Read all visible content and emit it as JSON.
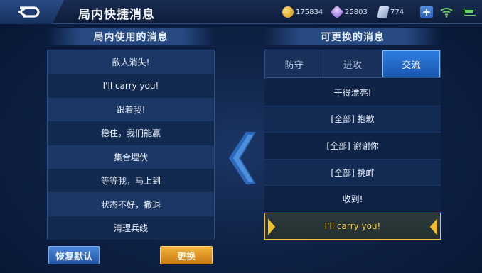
{
  "header": {
    "title": "局内快捷消息",
    "currencies": [
      {
        "icon": "gold-coin-icon",
        "value": "175834"
      },
      {
        "icon": "diamond-icon",
        "value": "25803"
      },
      {
        "icon": "voucher-icon",
        "value": "774"
      }
    ]
  },
  "left_panel": {
    "title": "局内使用的消息",
    "items": [
      "敌人消失!",
      "I'll carry you!",
      "跟着我!",
      "稳住，我们能赢",
      "集合埋伏",
      "等等我，马上到",
      "状态不好，撤退",
      "清理兵线"
    ]
  },
  "right_panel": {
    "title": "可更换的消息",
    "tabs": [
      "防守",
      "进攻",
      "交流"
    ],
    "active_tab": "交流",
    "items": [
      "干得漂亮!",
      "[全部] 抱歉",
      "[全部] 谢谢你",
      "[全部] 挑衅",
      "收到!",
      "I'll carry you!"
    ],
    "selected_item": "I'll carry you!"
  },
  "buttons": {
    "reset": "恢复默认",
    "replace": "更换"
  },
  "colors": {
    "accent_blue": "#2f7ee0",
    "selected_gold": "#f0c030",
    "replace_orange": "#f4b53c"
  }
}
